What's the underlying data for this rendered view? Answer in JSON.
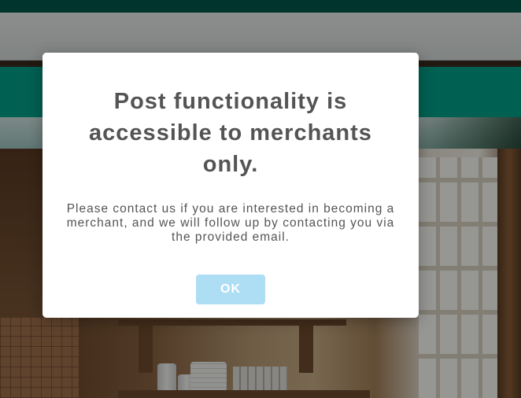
{
  "dialog": {
    "title": "Post functionality is accessible to merchants only.",
    "message": "Please contact us if you are interested in becoming a merchant, and we will follow up by contacting you via the provided email.",
    "ok_label": "OK"
  },
  "colors": {
    "ok_button_bg": "#aedef4",
    "title_text": "#545454",
    "header_teal": "#00a189"
  }
}
